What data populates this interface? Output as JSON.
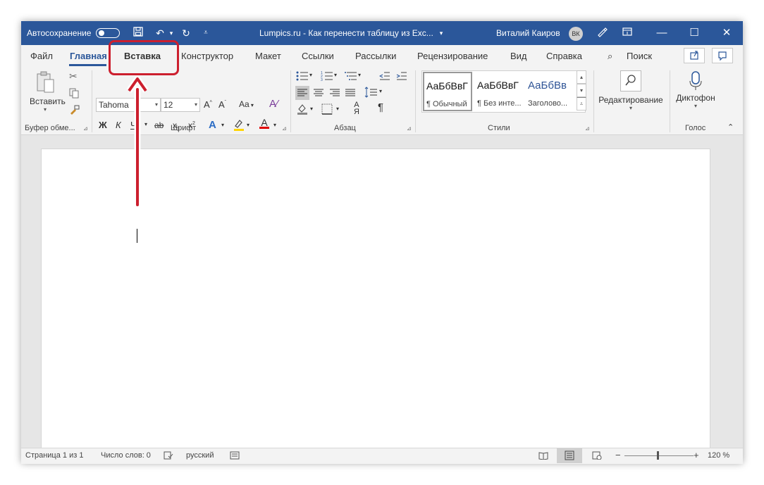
{
  "titlebar": {
    "autosave_label": "Автосохранение",
    "doc_title": "Lumpics.ru - Как перенести таблицу из Exc...",
    "user_name": "Виталий Каиров",
    "avatar_initials": "ВК",
    "color": "#2b579a"
  },
  "tabs": [
    "Файл",
    "Главная",
    "Вставка",
    "Конструктор",
    "Макет",
    "Ссылки",
    "Рассылки",
    "Рецензирование",
    "Вид",
    "Справка"
  ],
  "search_label": "Поиск",
  "clipboard": {
    "paste_label": "Вставить",
    "group_label": "Буфер обме..."
  },
  "font": {
    "font_name": "Tahoma",
    "font_size": "12",
    "change_case": "Aa",
    "bold": "Ж",
    "italic": "К",
    "underline": "Ч",
    "strike": "ab",
    "group_label": "Шрифт"
  },
  "paragraph": {
    "group_label": "Абзац"
  },
  "styles": {
    "items": [
      {
        "sample": "АаБбВвГ",
        "name": "¶ Обычный"
      },
      {
        "sample": "АаБбВвГ",
        "name": "¶ Без инте..."
      },
      {
        "sample": "АаБбВв",
        "name": "Заголово..."
      }
    ],
    "group_label": "Стили"
  },
  "editing": {
    "label": "Редактирование"
  },
  "voice": {
    "label": "Диктофон",
    "group_label": "Голос"
  },
  "statusbar": {
    "page_info": "Страница 1 из 1",
    "word_count": "Число слов: 0",
    "language": "русский",
    "zoom": "120 %"
  },
  "annotation": {
    "color": "#cc1f2e"
  }
}
